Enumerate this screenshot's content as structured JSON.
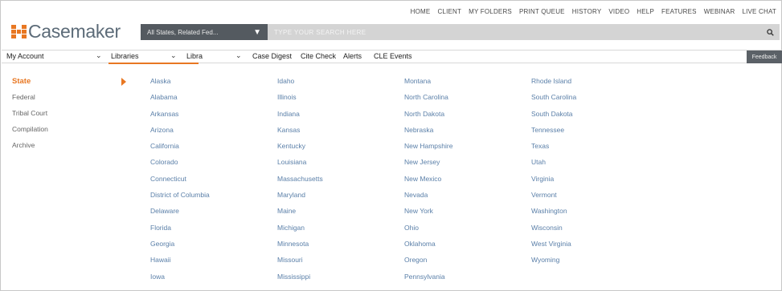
{
  "top_nav": [
    "HOME",
    "CLIENT",
    "MY FOLDERS",
    "PRINT QUEUE",
    "HISTORY",
    "VIDEO",
    "HELP",
    "FEATURES",
    "WEBINAR",
    "LIVE CHAT"
  ],
  "logo": {
    "text": "Casemaker",
    "accent_color": "#e87722"
  },
  "search": {
    "scope_value": "All States, Related Fed...",
    "placeholder": "TYPE YOUR SEARCH HERE",
    "button_icon": "search-icon"
  },
  "menu": {
    "my_account": "My Account",
    "libraries": "Libraries",
    "libra": "Libra",
    "case_digest": "Case Digest",
    "cite_check": "Cite Check",
    "alerts": "Alerts",
    "cle_events": "CLE Events",
    "feedback": "Feedback"
  },
  "library_types": [
    "State",
    "Federal",
    "Tribal Court",
    "Compilation",
    "Archive"
  ],
  "states": {
    "col1": [
      "Alaska",
      "Alabama",
      "Arkansas",
      "Arizona",
      "California",
      "Colorado",
      "Connecticut",
      "District of Columbia",
      "Delaware",
      "Florida",
      "Georgia",
      "Hawaii",
      "Iowa"
    ],
    "col2": [
      "Idaho",
      "Illinois",
      "Indiana",
      "Kansas",
      "Kentucky",
      "Louisiana",
      "Massachusetts",
      "Maryland",
      "Maine",
      "Michigan",
      "Minnesota",
      "Missouri",
      "Mississippi"
    ],
    "col3": [
      "Montana",
      "North Carolina",
      "North Dakota",
      "Nebraska",
      "New Hampshire",
      "New Jersey",
      "New Mexico",
      "Nevada",
      "New York",
      "Ohio",
      "Oklahoma",
      "Oregon",
      "Pennsylvania"
    ],
    "col4": [
      "Rhode Island",
      "South Carolina",
      "South Dakota",
      "Tennessee",
      "Texas",
      "Utah",
      "Virginia",
      "Vermont",
      "Washington",
      "Wisconsin",
      "West Virginia",
      "Wyoming"
    ]
  }
}
